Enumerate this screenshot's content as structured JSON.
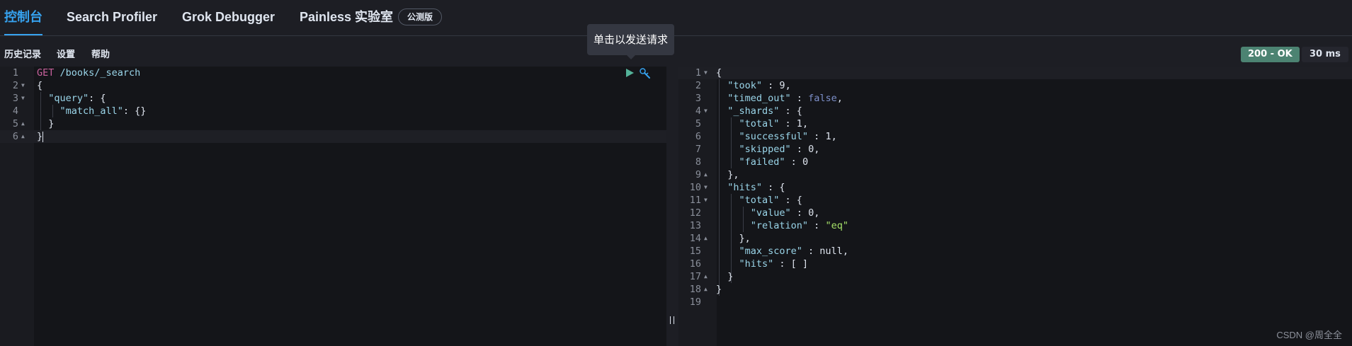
{
  "tabs": [
    {
      "label": "控制台",
      "active": true
    },
    {
      "label": "Search Profiler",
      "active": false
    },
    {
      "label": "Grok Debugger",
      "active": false
    },
    {
      "label": "Painless 实验室",
      "active": false
    }
  ],
  "beta_badge": "公测版",
  "toolbar": {
    "history": "历史记录",
    "settings": "设置",
    "help": "帮助"
  },
  "tooltip": "单击以发送请求",
  "status": {
    "code": "200 - OK",
    "time": "30 ms"
  },
  "request_editor": {
    "line_numbers": [
      "1",
      "2",
      "3",
      "4",
      "5",
      "6"
    ],
    "lines": [
      [
        {
          "t": "GET",
          "c": "method"
        },
        {
          "t": " /books/_search",
          "c": "url"
        }
      ],
      [
        {
          "t": "{",
          "c": "punc"
        }
      ],
      [
        {
          "t": "  \"query\"",
          "c": "key"
        },
        {
          "t": ": {",
          "c": "punc"
        }
      ],
      [
        {
          "t": "    \"match_all\"",
          "c": "key"
        },
        {
          "t": ": {}",
          "c": "punc"
        }
      ],
      [
        {
          "t": "  }",
          "c": "punc"
        }
      ],
      [
        {
          "t": "}",
          "c": "punc"
        }
      ]
    ]
  },
  "response_editor": {
    "line_numbers": [
      "1",
      "2",
      "3",
      "4",
      "5",
      "6",
      "7",
      "8",
      "9",
      "10",
      "11",
      "12",
      "13",
      "14",
      "15",
      "16",
      "17",
      "18",
      "19"
    ],
    "lines": [
      [
        {
          "t": "{",
          "c": "punc"
        }
      ],
      [
        {
          "t": "  \"took\"",
          "c": "key"
        },
        {
          "t": " : ",
          "c": "punc"
        },
        {
          "t": "9",
          "c": "num"
        },
        {
          "t": ",",
          "c": "punc"
        }
      ],
      [
        {
          "t": "  \"timed_out\"",
          "c": "key"
        },
        {
          "t": " : ",
          "c": "punc"
        },
        {
          "t": "false",
          "c": "bool"
        },
        {
          "t": ",",
          "c": "punc"
        }
      ],
      [
        {
          "t": "  \"_shards\"",
          "c": "key"
        },
        {
          "t": " : {",
          "c": "punc"
        }
      ],
      [
        {
          "t": "    \"total\"",
          "c": "key"
        },
        {
          "t": " : ",
          "c": "punc"
        },
        {
          "t": "1",
          "c": "num"
        },
        {
          "t": ",",
          "c": "punc"
        }
      ],
      [
        {
          "t": "    \"successful\"",
          "c": "key"
        },
        {
          "t": " : ",
          "c": "punc"
        },
        {
          "t": "1",
          "c": "num"
        },
        {
          "t": ",",
          "c": "punc"
        }
      ],
      [
        {
          "t": "    \"skipped\"",
          "c": "key"
        },
        {
          "t": " : ",
          "c": "punc"
        },
        {
          "t": "0",
          "c": "num"
        },
        {
          "t": ",",
          "c": "punc"
        }
      ],
      [
        {
          "t": "    \"failed\"",
          "c": "key"
        },
        {
          "t": " : ",
          "c": "punc"
        },
        {
          "t": "0",
          "c": "num"
        }
      ],
      [
        {
          "t": "  },",
          "c": "punc"
        }
      ],
      [
        {
          "t": "  \"hits\"",
          "c": "key"
        },
        {
          "t": " : {",
          "c": "punc"
        }
      ],
      [
        {
          "t": "    \"total\"",
          "c": "key"
        },
        {
          "t": " : {",
          "c": "punc"
        }
      ],
      [
        {
          "t": "      \"value\"",
          "c": "key"
        },
        {
          "t": " : ",
          "c": "punc"
        },
        {
          "t": "0",
          "c": "num"
        },
        {
          "t": ",",
          "c": "punc"
        }
      ],
      [
        {
          "t": "      \"relation\"",
          "c": "key"
        },
        {
          "t": " : ",
          "c": "punc"
        },
        {
          "t": "\"eq\"",
          "c": "str"
        }
      ],
      [
        {
          "t": "    },",
          "c": "punc"
        }
      ],
      [
        {
          "t": "    \"max_score\"",
          "c": "key"
        },
        {
          "t": " : null,",
          "c": "punc"
        }
      ],
      [
        {
          "t": "    \"hits\"",
          "c": "key"
        },
        {
          "t": " : [ ]",
          "c": "punc"
        }
      ],
      [
        {
          "t": "  }",
          "c": "punc"
        }
      ],
      [
        {
          "t": "}",
          "c": "punc"
        }
      ],
      []
    ]
  },
  "watermark": "CSDN @周全全",
  "colors": {
    "accent": "#36a2ef",
    "status_ok": "#4c8372",
    "send_icon": "#54b399"
  },
  "icons": {
    "send": "play-icon",
    "wrench": "wrench-icon"
  }
}
